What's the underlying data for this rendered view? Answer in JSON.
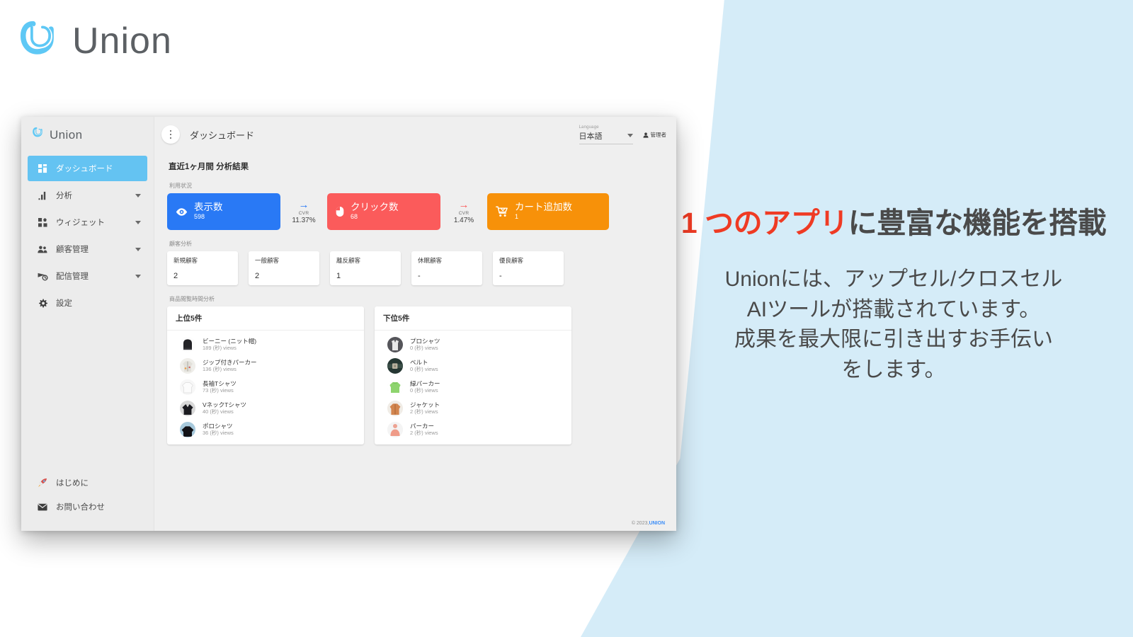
{
  "brand": {
    "name": "Union"
  },
  "sidebar": {
    "brand": "Union",
    "items": [
      {
        "label": "ダッシュボード",
        "icon": "dashboard-icon",
        "active": true,
        "caret": false
      },
      {
        "label": "分析",
        "icon": "chart-icon",
        "active": false,
        "caret": true
      },
      {
        "label": "ウィジェット",
        "icon": "widget-icon",
        "active": false,
        "caret": true
      },
      {
        "label": "顧客管理",
        "icon": "people-icon",
        "active": false,
        "caret": true
      },
      {
        "label": "配信管理",
        "icon": "send-icon",
        "active": false,
        "caret": true
      },
      {
        "label": "設定",
        "icon": "gear-icon",
        "active": false,
        "caret": false
      }
    ],
    "bottom_items": [
      {
        "label": "はじめに",
        "icon": "rocket-icon"
      },
      {
        "label": "お問い合わせ",
        "icon": "mail-icon"
      }
    ]
  },
  "topbar": {
    "menu_icon": "kebab-menu-icon",
    "page_title": "ダッシュボード",
    "language_label": "Language",
    "language_value": "日本語",
    "user_icon": "person-icon",
    "user_name": "管理者"
  },
  "main": {
    "section_title": "直近1ヶ月間 分析結果",
    "usage_label": "利用状況",
    "customer_label": "顧客分析",
    "product_label": "商品閲覧時間分析"
  },
  "kpi": {
    "cards": [
      {
        "name": "表示数",
        "value": "598",
        "icon": "eye-icon",
        "color": "#2979f5"
      },
      {
        "name": "クリック数",
        "value": "68",
        "icon": "mouse-icon",
        "color": "#fb5b5b"
      },
      {
        "name": "カート追加数",
        "value": "1",
        "icon": "cart-icon",
        "color": "#f79109"
      }
    ],
    "connectors": [
      {
        "arrow": "→",
        "cvr_label": "CVR",
        "cvr_value": "11.37%"
      },
      {
        "arrow": "→",
        "cvr_label": "CVR",
        "cvr_value": "1.47%"
      }
    ]
  },
  "customers": [
    {
      "name": "新規顧客",
      "value": "2"
    },
    {
      "name": "一般顧客",
      "value": "2"
    },
    {
      "name": "離反顧客",
      "value": "1"
    },
    {
      "name": "休眠顧客",
      "value": "-"
    },
    {
      "name": "優良顧客",
      "value": "-"
    }
  ],
  "products": {
    "top": {
      "title": "上位5件",
      "items": [
        {
          "name": "ビーニー (ニット帽)",
          "views": "189 (秒) views",
          "c1": "#2d2d30",
          "c2": "#111113"
        },
        {
          "name": "ジップ付きパーカー",
          "views": "136 (秒) views",
          "c1": "#e9e9e6",
          "c2": "#b9b6ad"
        },
        {
          "name": "長袖Tシャツ",
          "views": "73 (秒) views",
          "c1": "#fbfbfb",
          "c2": "#dedede"
        },
        {
          "name": "VネックTシャツ",
          "views": "40 (秒) views",
          "c1": "#31313a",
          "c2": "#0e0e12"
        },
        {
          "name": "ポロシャツ",
          "views": "36 (秒) views",
          "c1": "#9fc4da",
          "c2": "#131318"
        }
      ]
    },
    "bottom": {
      "title": "下位5件",
      "items": [
        {
          "name": "プロシャツ",
          "views": "0 (秒) views",
          "c1": "#6e6e72",
          "c2": "#2a2a2e"
        },
        {
          "name": "ベルト",
          "views": "0 (秒) views",
          "c1": "#2f4442",
          "c2": "#16201f"
        },
        {
          "name": "緑パーカー",
          "views": "0 (秒) views",
          "c1": "#8fd66f",
          "c2": "#71bd52"
        },
        {
          "name": "ジャケット",
          "views": "2 (秒) views",
          "c1": "#d98a5e",
          "c2": "#b9693e"
        },
        {
          "name": "パーカー",
          "views": "2 (秒) views",
          "c1": "#f0b8ae",
          "c2": "#e08b7d"
        }
      ]
    }
  },
  "footer": {
    "copyright": "© 2023,",
    "brand": "UNION"
  },
  "promo": {
    "headline_highlight": "1 つのアプリ",
    "headline_rest": "に豊富な機能を搭載",
    "body": "Unionには、アップセル/クロスセル\nAIツールが搭載されています。\n成果を最大限に引き出すお手伝い\nをします。"
  },
  "colors": {
    "accent_blue": "#64c3f2",
    "kpi_blue": "#2979f5",
    "kpi_red": "#fb5b5b",
    "kpi_orange": "#f79109",
    "promo_red": "#ef3b24",
    "panel_bg": "#d5ecf8"
  }
}
